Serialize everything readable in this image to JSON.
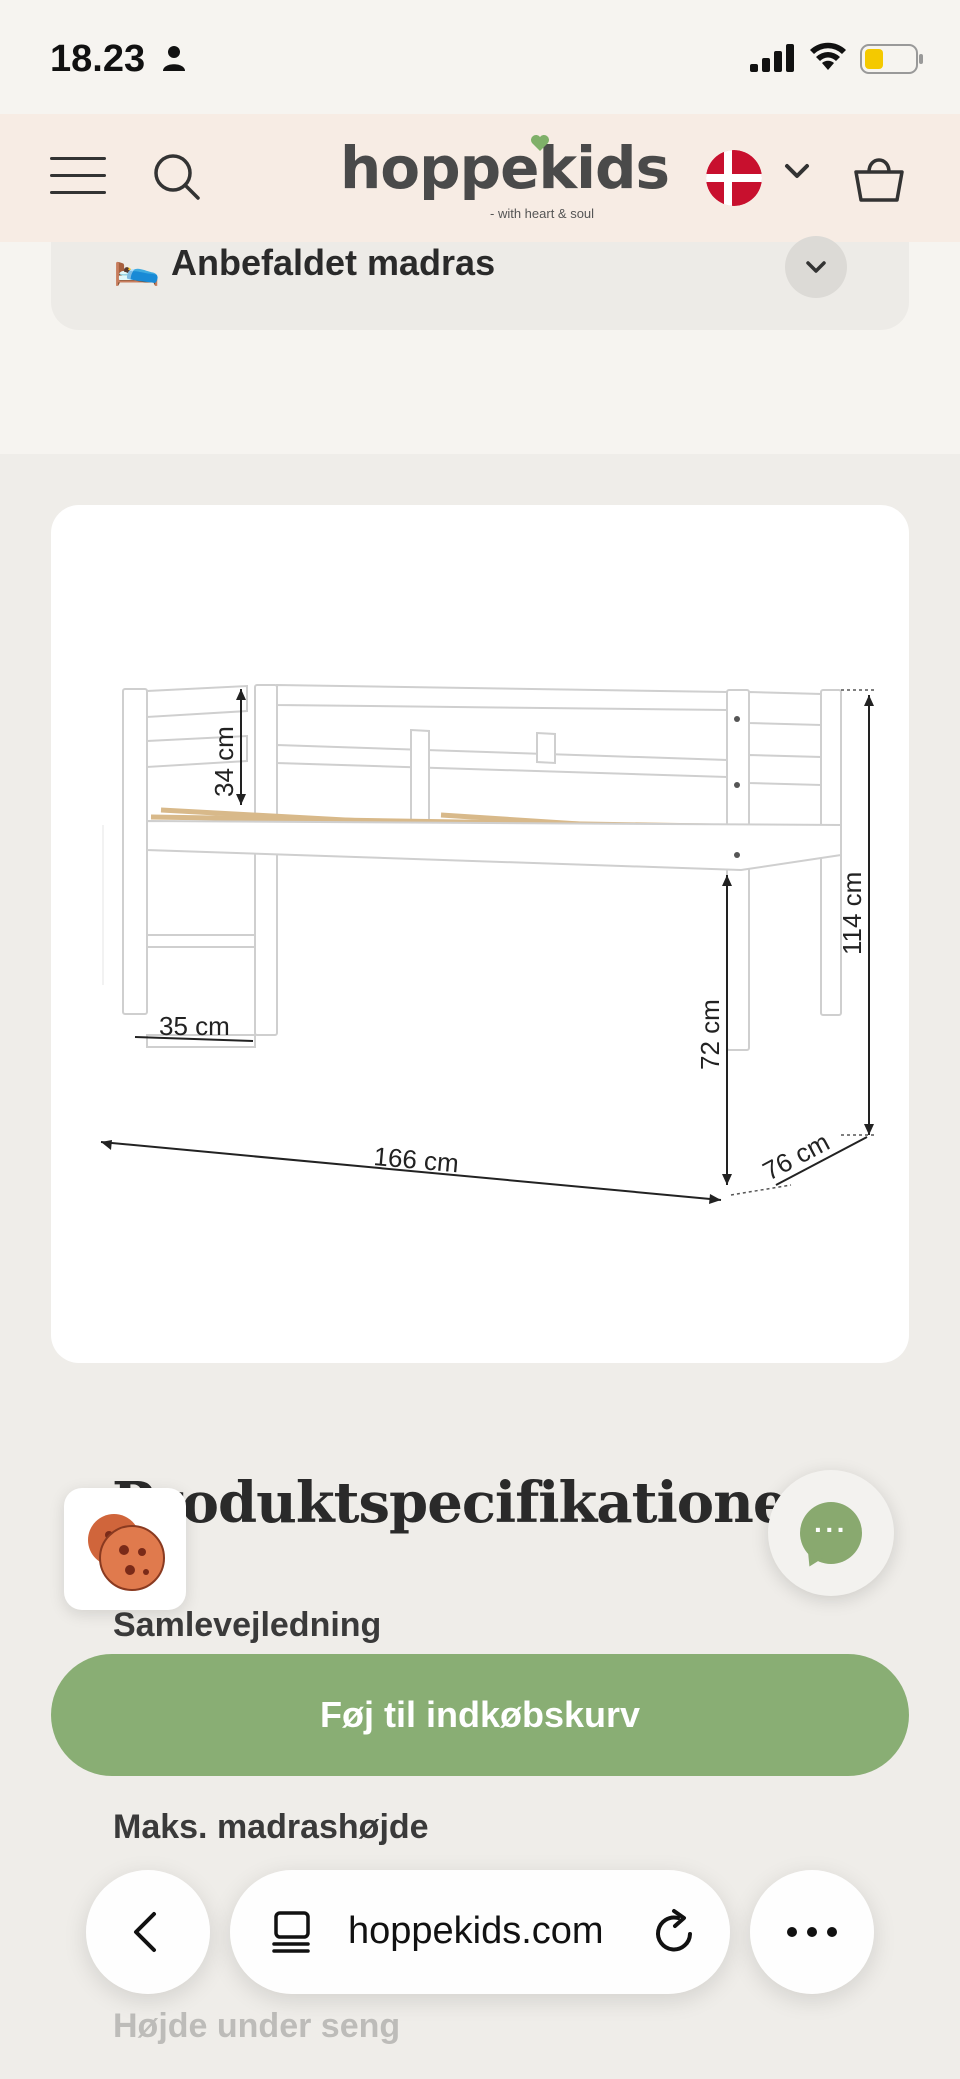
{
  "status_bar": {
    "time": "18.23"
  },
  "header": {
    "logo_text": "hoppekids",
    "logo_tagline": "- with heart & soul",
    "flag": "denmark-flag"
  },
  "accordion": {
    "emoji": "🛌",
    "title": "Anbefaldet madras"
  },
  "product_image": {
    "dimensions": {
      "guard_height": "34 cm",
      "ladder_width": "35 cm",
      "length": "166 cm",
      "clearance": "72 cm",
      "total_height": "114 cm",
      "depth": "76 cm"
    }
  },
  "specs": {
    "title": "Produktspecifikationer",
    "rows": [
      {
        "label": "Samlevejledning"
      },
      {
        "label": "Maks. madrashøjde"
      },
      {
        "label": "Højde under seng"
      }
    ]
  },
  "cta": {
    "add_to_cart": "Føj til indkøbskurv"
  },
  "browser": {
    "url": "hoppekids.com"
  },
  "colors": {
    "accent_green": "#89ae74",
    "header_bg": "#f7ece4",
    "page_bg": "#efede9"
  }
}
